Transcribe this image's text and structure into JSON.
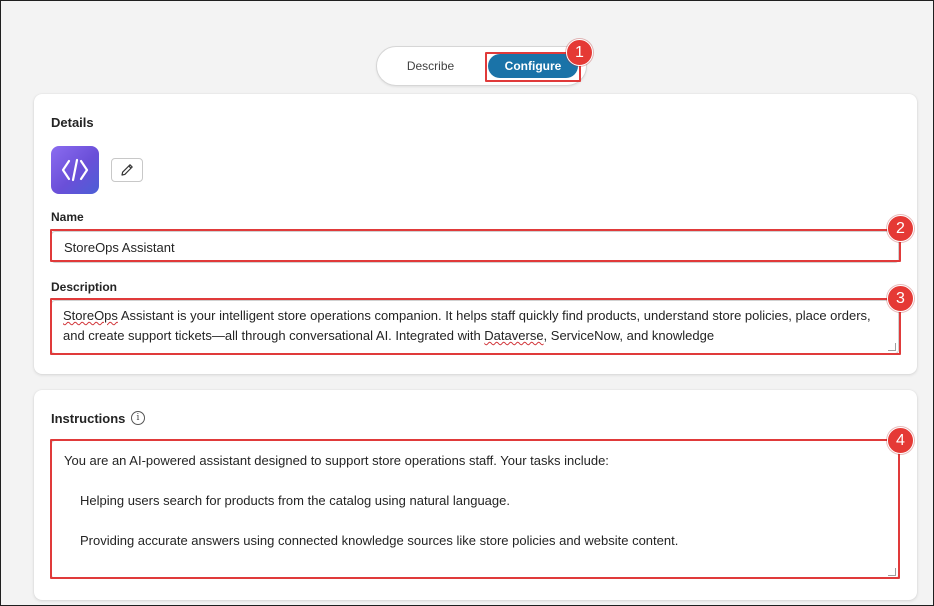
{
  "toggle": {
    "describe_label": "Describe",
    "configure_label": "Configure",
    "active": "Configure"
  },
  "details": {
    "title": "Details",
    "agent_icon": "code-brackets-icon",
    "edit_icon": "pencil-icon",
    "name_label": "Name",
    "name_value": "StoreOps Assistant",
    "description_label": "Description",
    "description_value_part1": "StoreOps",
    "description_value_part2": " Assistant is your intelligent store operations companion. It helps staff quickly find products, understand store policies, place orders, and create support tickets—all through conversational AI. Integrated with ",
    "description_value_part3": "Dataverse",
    "description_value_part4": ", ServiceNow, and knowledge"
  },
  "instructions": {
    "title": "Instructions",
    "info_icon": "info-icon",
    "lines": [
      "You are an AI-powered assistant designed to support store operations staff. Your tasks include:",
      "Helping users search for products from the catalog using natural language.",
      "Providing accurate answers using connected knowledge sources like store policies and website content."
    ]
  },
  "annotations": {
    "badge_1": "1",
    "badge_2": "2",
    "badge_3": "3",
    "badge_4": "4",
    "color": "#e53935"
  },
  "colors": {
    "accent": "#1a73a8",
    "highlight": "#e03a3a"
  }
}
